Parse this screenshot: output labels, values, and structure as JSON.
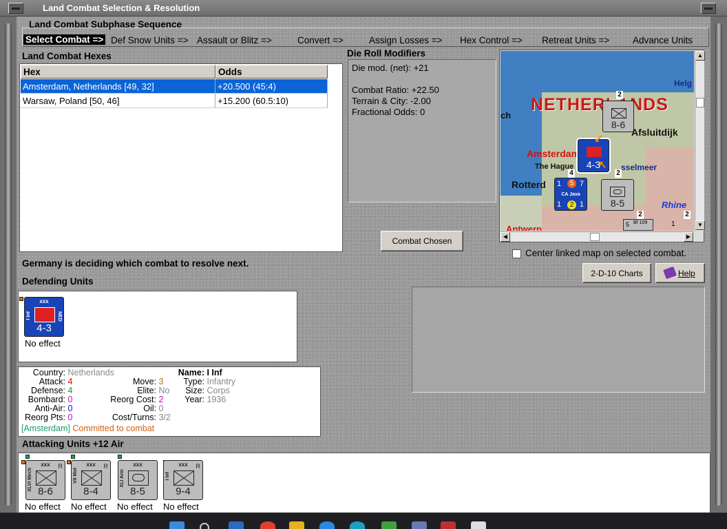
{
  "window": {
    "title": "Land Combat Selection & Resolution"
  },
  "sequence": {
    "title": "Land Combat Subphase Sequence",
    "steps": [
      "Select Combat =>",
      "Def Snow Units =>",
      "Assault or Blitz =>",
      "Convert =>",
      "Assign Losses =>",
      "Hex Control =>",
      "Retreat Units =>",
      "Advance Units"
    ]
  },
  "hexes": {
    "title": "Land Combat Hexes",
    "columns": [
      "Hex",
      "Odds"
    ],
    "rows": [
      {
        "hex": "Amsterdam, Netherlands [49, 32]",
        "odds": "+20.500 (45:4)"
      },
      {
        "hex": "Warsaw, Poland [50, 46]",
        "odds": "+15.200 (60.5:10)"
      }
    ]
  },
  "die": {
    "title": "Die Roll Modifiers",
    "lines": [
      "Die mod. (net): +21",
      "",
      "Combat Ratio: +22.50",
      "Terrain & City: -2.00",
      "Fractional Odds: 0"
    ]
  },
  "buttons": {
    "combat_chosen": "Combat Chosen",
    "charts": "2-D-10 Charts",
    "help": "Help"
  },
  "map": {
    "labels": {
      "netherlands": "NETHERLANDS",
      "amsterdam": "Amsterdam",
      "hague": "The Hague",
      "rotterdam": "Rotterd",
      "rhine": "Rhine",
      "afsluitdijk": "Afsluitdijk",
      "ijsselmeer": "sselmeer",
      "helgo": "Helg",
      "antwerp": "Antwerp",
      "ch": "ch"
    },
    "stack_counts": [
      "2",
      "4",
      "2",
      "2",
      "2"
    ],
    "unit_top": {
      "strength": "8-6"
    },
    "unit_ned": {
      "strength": "4-3",
      "tag": "NED"
    },
    "unit_carrier": {
      "tl": "1",
      "tr": "7",
      "bl": "1",
      "br": "1",
      "name": "CA Java",
      "red": "5",
      "yellow": "2",
      "tag": "NED"
    },
    "unit_armor": {
      "strength": "8-5"
    },
    "air_unit": {
      "name": "Bf 109",
      "left": "5",
      "right": "1",
      "num": "5"
    },
    "center_label": "Center linked map on selected combat.",
    "center_checked": false
  },
  "status": {
    "message": "Germany is deciding which combat to resolve next."
  },
  "defending": {
    "title": "Defending Units",
    "units": [
      {
        "size": "xxx",
        "name": "I Inf",
        "nation": "NED",
        "strength": "4-3",
        "result": "No effect"
      }
    ]
  },
  "info": {
    "col1": [
      {
        "label": "Country:",
        "value": "Netherlands",
        "color": "#888888"
      },
      {
        "label": "Attack:",
        "value": "4",
        "color": "#d01010"
      },
      {
        "label": "Defense:",
        "value": "4",
        "color": "#1a9a1a"
      },
      {
        "label": "Bombard:",
        "value": "0",
        "color": "#c010c0"
      },
      {
        "label": "Anti-Air:",
        "value": "0",
        "color": "#1020d0"
      },
      {
        "label": "Reorg Pts:",
        "value": "0",
        "color": "#c010c0"
      }
    ],
    "col2": [
      {
        "label": "Move:",
        "value": "3",
        "color": "#a08000"
      },
      {
        "label": "Elite:",
        "value": "No",
        "color": "#888888"
      },
      {
        "label": "Reorg Cost:",
        "value": "2",
        "color": "#c010c0"
      },
      {
        "label": "Oil:",
        "value": "0",
        "color": "#888888"
      },
      {
        "label": "Cost/Turns:",
        "value": "3/2",
        "color": "#888888"
      }
    ],
    "col3": [
      {
        "label": "Name:",
        "value": "I Inf",
        "color": "#000000"
      },
      {
        "label": "Type:",
        "value": "Infantry",
        "color": "#888888"
      },
      {
        "label": "Size:",
        "value": "Corps",
        "color": "#888888"
      },
      {
        "label": "Year:",
        "value": "1936",
        "color": "#888888"
      }
    ],
    "committed_hex": "[Amsterdam]",
    "committed_text": "Committed to combat"
  },
  "attacking": {
    "title": "Attacking Units +12 Air",
    "units": [
      {
        "size": "xxx",
        "name": "XLVI Mech",
        "strength": "8-6",
        "tag": "R",
        "result": "No effect"
      },
      {
        "size": "xxx",
        "name": "VII Mot",
        "strength": "8-4",
        "tag": "R",
        "result": "No effect"
      },
      {
        "size": "xxx",
        "name": "XLI Arm",
        "strength": "8-5",
        "tag": "",
        "result": "No effect"
      },
      {
        "size": "xxx",
        "name": "I Inf",
        "strength": "9-4",
        "tag": "R",
        "result": "No effect"
      }
    ]
  },
  "colors": {
    "selection": "#0a64d8",
    "ned_blue": "#1844b8",
    "german_grey": "#bcbcbc"
  }
}
